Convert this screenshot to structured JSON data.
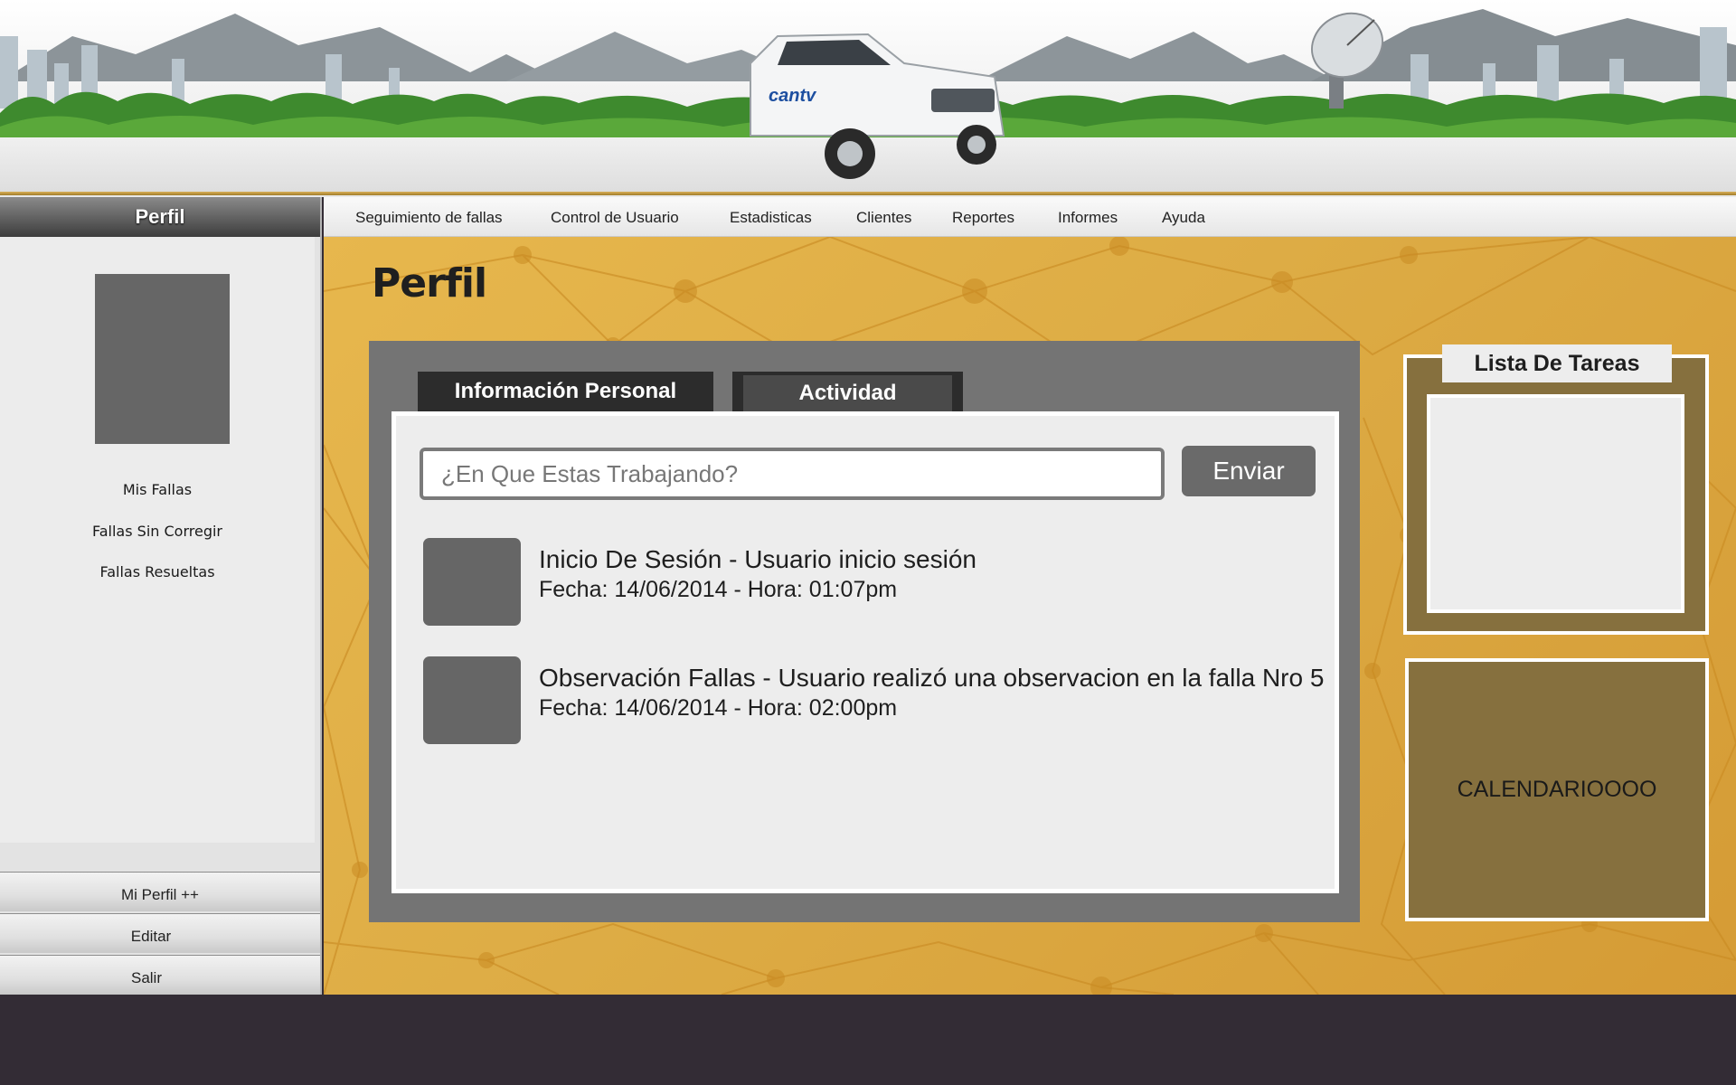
{
  "sidebar": {
    "title": "Perfil",
    "links": [
      "Mis Fallas",
      "Fallas Sin Corregir",
      "Fallas Resueltas"
    ],
    "buttons": [
      "Mi Perfil ++",
      "Editar",
      "Salir"
    ]
  },
  "nav": {
    "items": [
      "Seguimiento de fallas",
      "Control de Usuario",
      "Estadisticas",
      "Clientes",
      "Reportes",
      "Informes",
      "Ayuda"
    ]
  },
  "header": {
    "truck_brand": "cantv"
  },
  "main": {
    "page_title": "Perfil",
    "tabs": [
      "Información Personal",
      "Actividad"
    ],
    "status_placeholder": "¿En Que Estas Trabajando?",
    "send_label": "Enviar",
    "activities": [
      {
        "title": "Inicio De Sesión - Usuario inicio sesión",
        "date": "Fecha: 14/06/2014 - Hora: 01:07pm"
      },
      {
        "title": "Observación Fallas - Usuario realizó una observacion en la falla Nro 5",
        "date": "Fecha: 14/06/2014 - Hora: 02:00pm"
      }
    ]
  },
  "right": {
    "tasks_title": "Lista De Tareas",
    "calendar_label": "CALENDARIOOOO"
  },
  "colors": {
    "accent_gold": "#ddac45",
    "panel_gray": "#747474",
    "box_brown": "#86703e",
    "footer": "#332c35"
  }
}
